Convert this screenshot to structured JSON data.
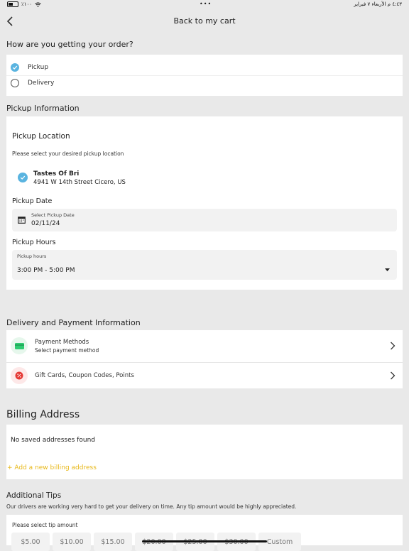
{
  "status": {
    "battery_text": "٪١٠٠",
    "datetime": "٤:٤٣ م  الأربعاء ٧ فبراير"
  },
  "nav": {
    "title": "Back to my cart"
  },
  "order_method": {
    "question": "How are you getting your order?",
    "options": [
      {
        "label": "Pickup",
        "selected": true
      },
      {
        "label": "Delivery",
        "selected": false
      }
    ]
  },
  "pickup_info": {
    "section_title": "Pickup Information",
    "location_title": "Pickup Location",
    "location_hint": "Please select your desired pickup location",
    "store": {
      "name": "Tastes Of Bri",
      "address": "4941 W 14th Street Cicero, US"
    },
    "date_title": "Pickup Date",
    "date_field": {
      "label": "Select Pickup Date",
      "value": "02/11/24"
    },
    "hours_title": "Pickup Hours",
    "hours_field": {
      "label": "Pickup hours",
      "value": "3:00 PM - 5:00 PM"
    }
  },
  "delivery_payment": {
    "section_title": "Delivery and Payment Information",
    "payment": {
      "title": "Payment Methods",
      "subtitle": "Select payment method"
    },
    "gift": {
      "title": "Gift Cards, Coupon Codes, Points"
    }
  },
  "billing": {
    "title": "Billing Address",
    "empty_text": "No saved addresses found",
    "add_link": "+ Add a new billing address"
  },
  "tips": {
    "title": "Additional Tips",
    "description": "Our drivers are working very hard to get your delivery on time. Any tip amount would be highly appreciated.",
    "prompt": "Please select tip amount",
    "options": [
      "$5.00",
      "$10.00",
      "$15.00",
      "$20.00",
      "$25.00",
      "$30.00",
      "Custom"
    ]
  },
  "colors": {
    "accent_blue": "#5ab4e0",
    "link_yellow": "#e8b819",
    "card_green": "#2ecc71",
    "gift_red": "#e53935"
  }
}
